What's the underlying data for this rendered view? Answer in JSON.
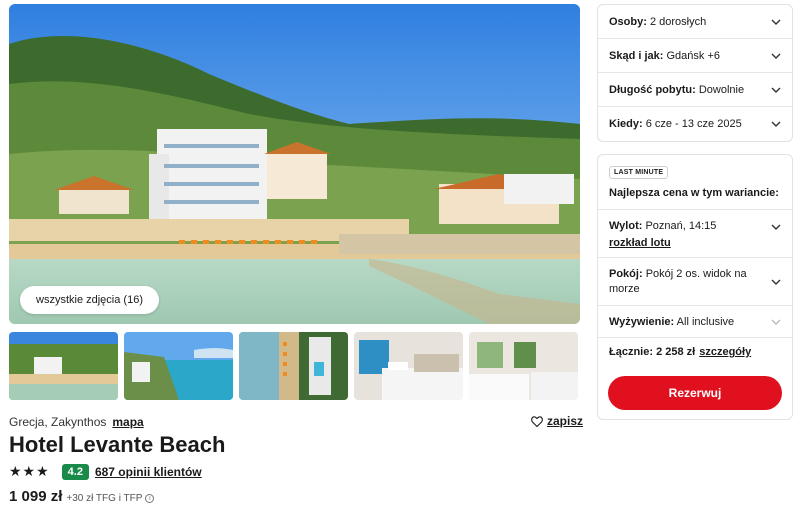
{
  "hero": {
    "all_photos_label": "wszystkie zdjęcia (16)"
  },
  "thumbnails": [
    "beach-hotel-aerial",
    "coastline-view",
    "hotel-aerial-top",
    "bedroom-sea-view",
    "bedroom-interior"
  ],
  "hotel": {
    "location": "Grecja, Zakynthos",
    "map_label": "mapa",
    "save_label": "zapisz",
    "name": "Hotel Levante Beach",
    "stars": "★★★",
    "score": "4.2",
    "reviews_label": "687 opinii klientów",
    "price": "1 099 zł",
    "fees": "+30 zł TFG i TFP"
  },
  "filters": {
    "guests_label": "Osoby:",
    "guests_value": "2 dorosłych",
    "from_label": "Skąd i jak:",
    "from_value": "Gdańsk +6",
    "duration_label": "Długość pobytu:",
    "duration_value": "Dowolnie",
    "when_label": "Kiedy:",
    "when_value": "6 cze - 13 cze 2025"
  },
  "offer": {
    "badge": "LAST MINUTE",
    "best_price": "Najlepsza cena w tym wariancie:",
    "flight_label": "Wylot:",
    "flight_value": "Poznań, 14:15",
    "flight_link": "rozkład lotu",
    "room_label": "Pokój:",
    "room_value": "Pokój 2 os. widok na morze",
    "board_label": "Wyżywienie:",
    "board_value": "All inclusive",
    "total_label": "Łącznie: 2 258 zł",
    "details_link": "szczegóły",
    "book_label": "Rezerwuj"
  },
  "colors": {
    "accent": "#e0101e",
    "score_bg": "#1a8a4b"
  }
}
